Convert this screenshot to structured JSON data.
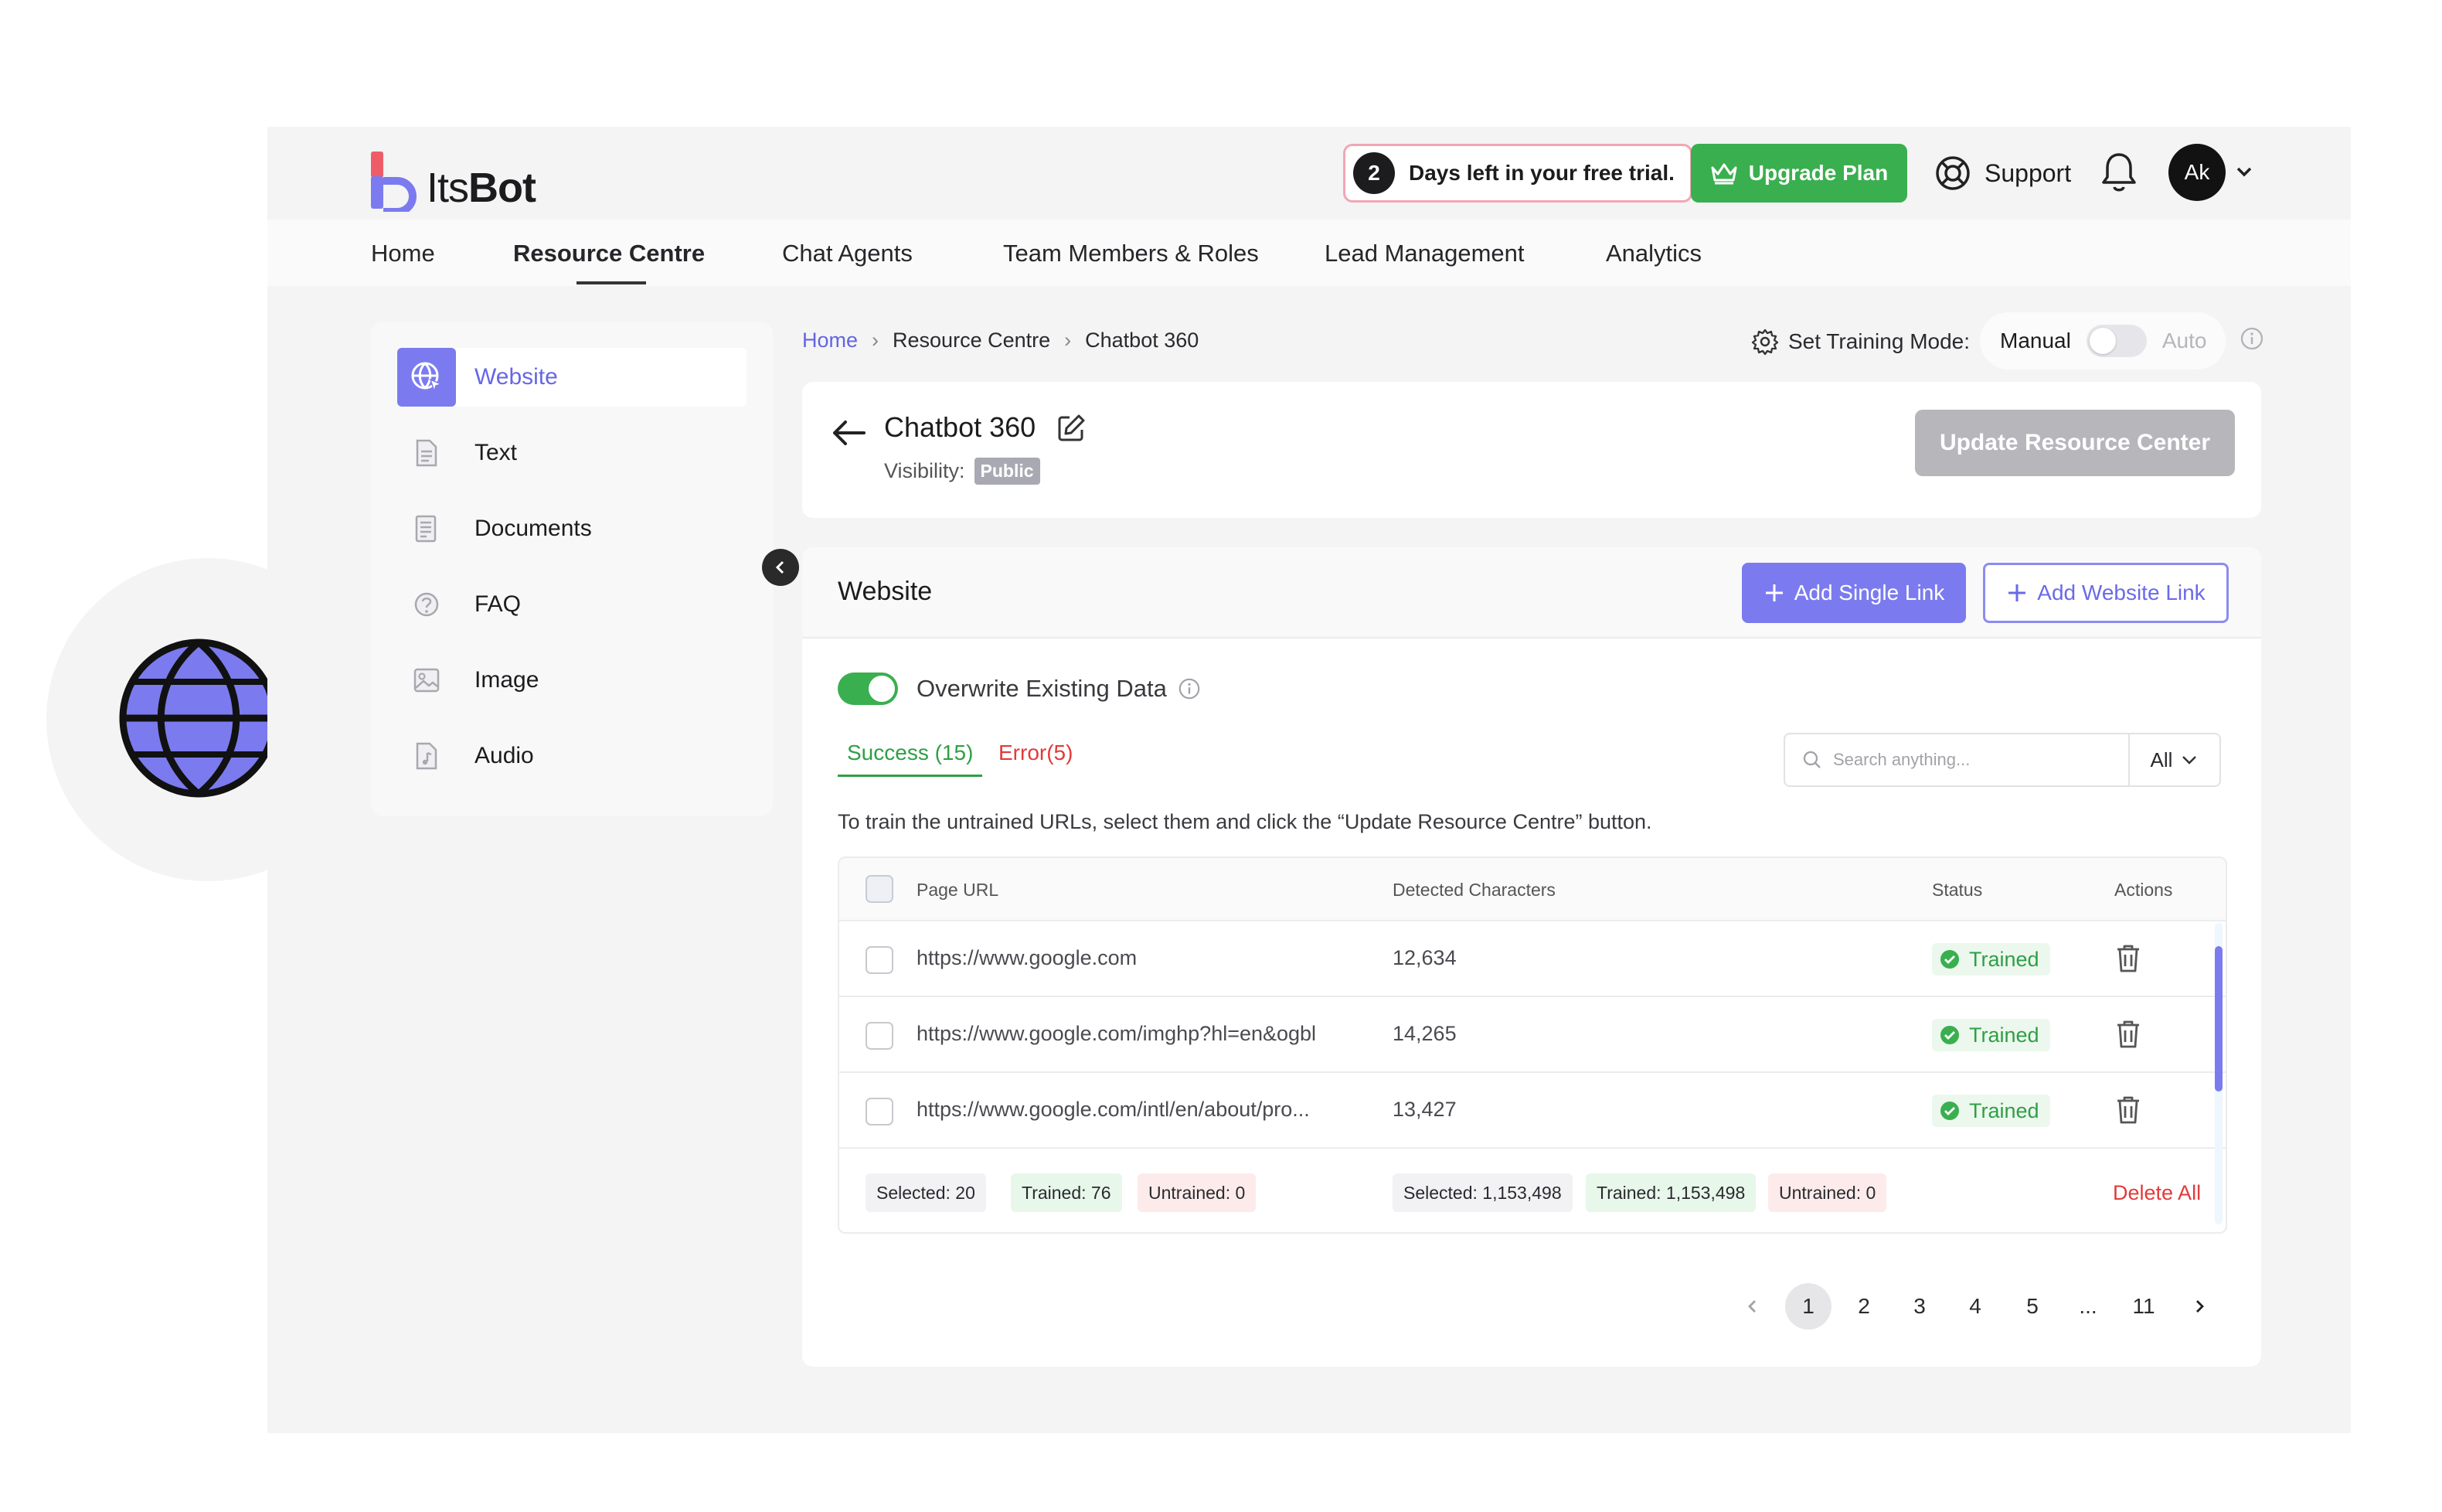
{
  "app": {
    "logo_its": "Its",
    "logo_bot": "Bot",
    "trial_days": "2",
    "trial_text": "Days left in your free trial.",
    "upgrade_label": "Upgrade Plan",
    "support_label": "Support",
    "avatar_initials": "Ak"
  },
  "nav": {
    "items": [
      "Home",
      "Resource Centre",
      "Chat Agents",
      "Team Members & Roles",
      "Lead Management",
      "Analytics"
    ],
    "active": "Resource Centre"
  },
  "sidebar": {
    "items": [
      {
        "label": "Website",
        "icon": "globe-icon",
        "active": true
      },
      {
        "label": "Text",
        "icon": "text-file-icon"
      },
      {
        "label": "Documents",
        "icon": "documents-icon"
      },
      {
        "label": "FAQ",
        "icon": "faq-icon"
      },
      {
        "label": "Image",
        "icon": "image-icon"
      },
      {
        "label": "Audio",
        "icon": "audio-file-icon"
      }
    ]
  },
  "breadcrumb": [
    "Home",
    "Resource Centre",
    "Chatbot 360"
  ],
  "training_mode": {
    "label": "Set Training Mode:",
    "manual": "Manual",
    "auto": "Auto",
    "current": "Manual"
  },
  "header": {
    "title": "Chatbot 360",
    "visibility_label": "Visibility:",
    "visibility_value": "Public",
    "update_label": "Update Resource Center"
  },
  "website": {
    "title": "Website",
    "add_single_label": "Add Single Link",
    "add_website_label": "Add Website Link",
    "overwrite_label": "Overwrite Existing Data",
    "overwrite_on": true,
    "tab_success": "Success (15)",
    "tab_error": "Error(5)",
    "search_placeholder": "Search anything...",
    "filter_value": "All",
    "hint": "To train the untrained URLs, select them and click the “Update Resource Centre” button."
  },
  "table": {
    "columns": [
      "Page URL",
      "Detected Characters",
      "Status",
      "Actions"
    ],
    "rows": [
      {
        "url": "https://www.google.com",
        "chars": "12,634",
        "status": "Trained"
      },
      {
        "url": "https://www.google.com/imghp?hl=en&ogbl",
        "chars": "14,265",
        "status": "Trained"
      },
      {
        "url": "https://www.google.com/intl/en/about/pro...",
        "chars": "13,427",
        "status": "Trained"
      }
    ],
    "footer": {
      "selected_urls": "Selected: 20",
      "trained_urls": "Trained: 76",
      "untrained_urls": "Untrained: 0",
      "selected_chars": "Selected: 1,153,498",
      "trained_chars": "Trained: 1,153,498",
      "untrained_chars": "Untrained: 0",
      "delete_all": "Delete All"
    }
  },
  "pagination": {
    "pages": [
      "1",
      "2",
      "3",
      "4",
      "5",
      "...",
      "11"
    ],
    "current": "1"
  },
  "colors": {
    "accent": "#7b7bef",
    "green": "#3aaf4f",
    "red": "#e23a3a"
  }
}
